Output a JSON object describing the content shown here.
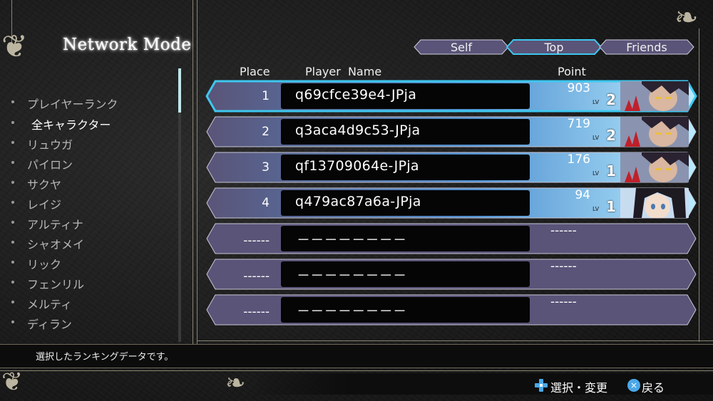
{
  "screen": {
    "title": "Network Mode"
  },
  "categories": [
    {
      "label": "プレイヤーランク",
      "selected": false
    },
    {
      "label": "全キャラクター",
      "selected": true
    },
    {
      "label": "リュウガ",
      "selected": false
    },
    {
      "label": "パイロン",
      "selected": false
    },
    {
      "label": "サクヤ",
      "selected": false
    },
    {
      "label": "レイジ",
      "selected": false
    },
    {
      "label": "アルティナ",
      "selected": false
    },
    {
      "label": "シャオメイ",
      "selected": false
    },
    {
      "label": "リック",
      "selected": false
    },
    {
      "label": "フェンリル",
      "selected": false
    },
    {
      "label": "メルティ",
      "selected": false
    },
    {
      "label": "ディラン",
      "selected": false
    }
  ],
  "tabs": [
    {
      "label": "Self",
      "active": false
    },
    {
      "label": "Top",
      "active": true
    },
    {
      "label": "Friends",
      "active": false
    }
  ],
  "columns": {
    "place": "Place",
    "player_name": "Player  Name",
    "point": "Point"
  },
  "rows": [
    {
      "place": "1",
      "name": "q69cfce39e4-JPja",
      "point": "903",
      "lv_tag": "LV",
      "lv": "2",
      "portrait": "male-character-icon"
    },
    {
      "place": "2",
      "name": "q3aca4d9c53-JPja",
      "point": "719",
      "lv_tag": "LV",
      "lv": "2",
      "portrait": "male-character-icon"
    },
    {
      "place": "3",
      "name": "qf13709064e-JPja",
      "point": "176",
      "lv_tag": "LV",
      "lv": "1",
      "portrait": "male-character-icon"
    },
    {
      "place": "4",
      "name": "q479ac87a6a-JPja",
      "point": "94",
      "lv_tag": "LV",
      "lv": "1",
      "portrait": "female-character-icon"
    },
    {
      "place": "------",
      "name": "－－－－－－－－",
      "point": "------"
    },
    {
      "place": "------",
      "name": "－－－－－－－－",
      "point": "------"
    },
    {
      "place": "------",
      "name": "－－－－－－－－",
      "point": "------"
    }
  ],
  "message": "選択したランキングデータです。",
  "hints": {
    "select_change": "選択・変更",
    "back": "戻る",
    "back_button_glyph": "×"
  },
  "colors": {
    "row_fill": "#5a5478",
    "row_selected_border": "#3ec8f0",
    "accent_cyan": "#7fe3f5",
    "gradient_blue": "#5fb8f0"
  }
}
